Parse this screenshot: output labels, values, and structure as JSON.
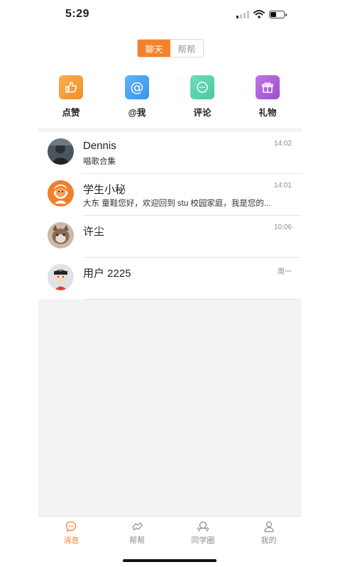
{
  "status_bar": {
    "time": "5:29"
  },
  "segment": {
    "tabs": [
      {
        "label": "聊天",
        "active": true
      },
      {
        "label": "帮帮",
        "active": false
      }
    ]
  },
  "quick_actions": [
    {
      "label": "点赞",
      "icon": "thumbs-up-icon",
      "color": "#f5a23c"
    },
    {
      "label": "@我",
      "icon": "at-icon",
      "color": "#4ea6f1"
    },
    {
      "label": "评论",
      "icon": "comment-icon",
      "color": "#5fd3b0"
    },
    {
      "label": "礼物",
      "icon": "gift-icon",
      "color": "#b063d9"
    }
  ],
  "conversations": [
    {
      "name": "Dennis",
      "message": "唱歌合集",
      "time": "14:02"
    },
    {
      "name": "学生小秘",
      "message": "大东 童鞋您好，欢迎回到 stu 校园家庭，我是您的...",
      "time": "14:01"
    },
    {
      "name": "许尘",
      "message": "",
      "time": "10:06"
    },
    {
      "name": "用户 2225",
      "message": "",
      "time": "周一"
    }
  ],
  "tabbar": [
    {
      "label": "消息",
      "icon": "message-icon",
      "active": true
    },
    {
      "label": "帮帮",
      "icon": "help-icon",
      "active": false
    },
    {
      "label": "同学圈",
      "icon": "classmates-icon",
      "active": false
    },
    {
      "label": "我的",
      "icon": "profile-icon",
      "active": false
    }
  ],
  "colors": {
    "accent": "#f5822a",
    "background_gray": "#f3f3f5"
  }
}
